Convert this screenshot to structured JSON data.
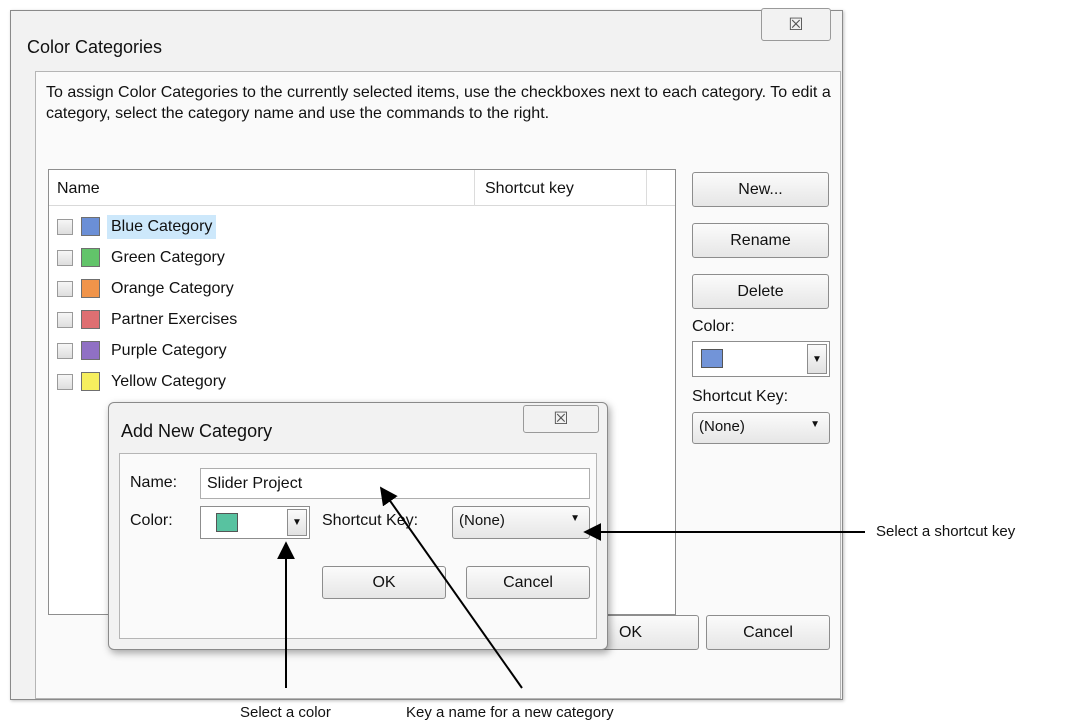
{
  "window": {
    "title": "Color Categories",
    "instructions": "To assign Color Categories to the currently selected items, use the checkboxes next to each category.  To edit a category, select the category name and use the commands to the right.",
    "columns": {
      "name": "Name",
      "shortcut": "Shortcut key"
    },
    "categories": [
      {
        "label": "Blue Category",
        "color": "#6b8fd6",
        "selected": true
      },
      {
        "label": "Green Category",
        "color": "#62c46a"
      },
      {
        "label": "Orange Category",
        "color": "#f0944a"
      },
      {
        "label": "Partner Exercises",
        "color": "#df6f72"
      },
      {
        "label": "Purple Category",
        "color": "#9070c4"
      },
      {
        "label": "Yellow Category",
        "color": "#f6ef5e"
      }
    ],
    "buttons": {
      "new": "New...",
      "rename": "Rename",
      "delete": "Delete",
      "ok": "OK",
      "cancel": "Cancel"
    },
    "color_label": "Color:",
    "color_value": "#7294d8",
    "shortcut_label": "Shortcut Key:",
    "shortcut_value": "(None)",
    "close_glyph": "☒"
  },
  "dialog": {
    "title": "Add New Category",
    "name_label": "Name:",
    "name_value": "Slider Project",
    "color_label": "Color:",
    "color_value": "#58c2a0",
    "shortcut_label": "Shortcut Key:",
    "shortcut_value": "(None)",
    "ok": "OK",
    "cancel": "Cancel",
    "close_glyph": "☒"
  },
  "callouts": {
    "shortcut": "Select a shortcut key",
    "color": "Select a color",
    "name": "Key a name for a new category"
  }
}
